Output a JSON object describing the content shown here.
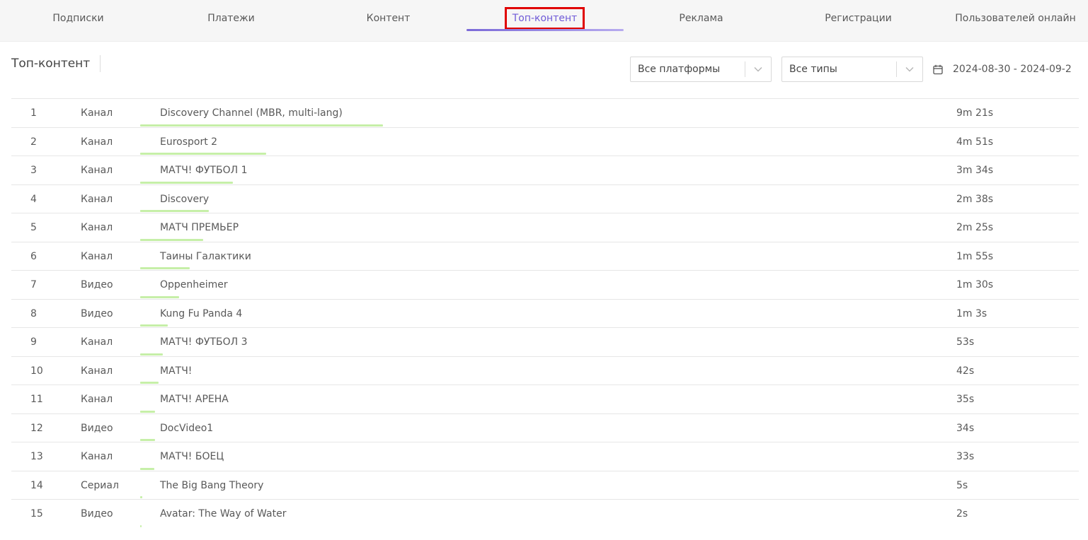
{
  "tabs": [
    {
      "label": "Подписки",
      "active": false
    },
    {
      "label": "Платежи",
      "active": false
    },
    {
      "label": "Контент",
      "active": false
    },
    {
      "label": "Топ-контент",
      "active": true
    },
    {
      "label": "Реклама",
      "active": false
    },
    {
      "label": "Регистрации",
      "active": false
    },
    {
      "label": "Пользователей онлайн",
      "active": false
    }
  ],
  "page": {
    "title": "Топ-контент"
  },
  "filters": {
    "platform": "Все платформы",
    "type": "Все типы",
    "date_range": "2024-08-30 - 2024-09-2"
  },
  "colors": {
    "accent": "#6f5bd8",
    "bar": "#c6efa8",
    "highlight_box": "#e00000"
  },
  "icons": {
    "select_arrow": "chevron-down-icon",
    "date": "calendar-icon"
  },
  "rows": [
    {
      "rank": "1",
      "type": "Канал",
      "title": "Discovery Channel (MBR, multi-lang)",
      "duration": "9m 21s",
      "seconds": 561
    },
    {
      "rank": "2",
      "type": "Канал",
      "title": "Eurosport 2",
      "duration": "4m 51s",
      "seconds": 291
    },
    {
      "rank": "3",
      "type": "Канал",
      "title": "МАТЧ! ФУТБОЛ 1",
      "duration": "3m 34s",
      "seconds": 214
    },
    {
      "rank": "4",
      "type": "Канал",
      "title": "Discovery",
      "duration": "2m 38s",
      "seconds": 158
    },
    {
      "rank": "5",
      "type": "Канал",
      "title": "МАТЧ ПРЕМЬЕР",
      "duration": "2m 25s",
      "seconds": 145
    },
    {
      "rank": "6",
      "type": "Канал",
      "title": "Таины Галактики",
      "duration": "1m 55s",
      "seconds": 115
    },
    {
      "rank": "7",
      "type": "Видео",
      "title": "Oppenheimer",
      "duration": "1m 30s",
      "seconds": 90
    },
    {
      "rank": "8",
      "type": "Видео",
      "title": "Kung Fu Panda 4",
      "duration": "1m 3s",
      "seconds": 63
    },
    {
      "rank": "9",
      "type": "Канал",
      "title": "МАТЧ! ФУТБОЛ 3",
      "duration": "53s",
      "seconds": 53
    },
    {
      "rank": "10",
      "type": "Канал",
      "title": "МАТЧ!",
      "duration": "42s",
      "seconds": 42
    },
    {
      "rank": "11",
      "type": "Канал",
      "title": "МАТЧ! АРЕНА",
      "duration": "35s",
      "seconds": 35
    },
    {
      "rank": "12",
      "type": "Видео",
      "title": "DocVideo1",
      "duration": "34s",
      "seconds": 34
    },
    {
      "rank": "13",
      "type": "Канал",
      "title": "МАТЧ! БОЕЦ",
      "duration": "33s",
      "seconds": 33
    },
    {
      "rank": "14",
      "type": "Сериал",
      "title": "The Big Bang Theory",
      "duration": "5s",
      "seconds": 5
    },
    {
      "rank": "15",
      "type": "Видео",
      "title": "Avatar: The Way of Water",
      "duration": "2s",
      "seconds": 2
    }
  ]
}
